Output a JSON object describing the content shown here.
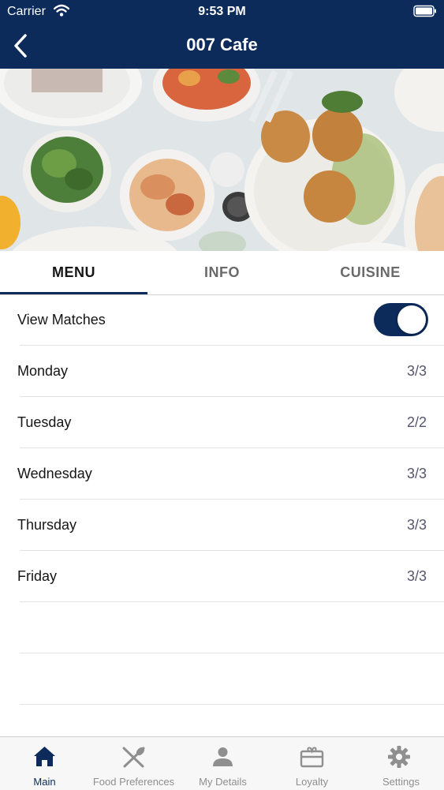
{
  "status_bar": {
    "carrier": "Carrier",
    "time": "9:53 PM"
  },
  "header": {
    "title": "007 Cafe"
  },
  "tabs": [
    {
      "label": "MENU",
      "active": true
    },
    {
      "label": "INFO",
      "active": false
    },
    {
      "label": "CUISINE",
      "active": false
    }
  ],
  "view_matches": {
    "label": "View Matches",
    "enabled": true
  },
  "days": [
    {
      "label": "Monday",
      "value": "3/3"
    },
    {
      "label": "Tuesday",
      "value": "2/2"
    },
    {
      "label": "Wednesday",
      "value": "3/3"
    },
    {
      "label": "Thursday",
      "value": "3/3"
    },
    {
      "label": "Friday",
      "value": "3/3"
    }
  ],
  "tab_bar": [
    {
      "label": "Main",
      "icon": "home-icon",
      "active": true
    },
    {
      "label": "Food Preferences",
      "icon": "fork-knife-icon",
      "active": false
    },
    {
      "label": "My Details",
      "icon": "person-icon",
      "active": false
    },
    {
      "label": "Loyalty",
      "icon": "gift-card-icon",
      "active": false
    },
    {
      "label": "Settings",
      "icon": "gear-icon",
      "active": false
    }
  ],
  "colors": {
    "brand": "#0c2a5a",
    "inactive": "#8f8f8f",
    "value_text": "#56566e"
  }
}
